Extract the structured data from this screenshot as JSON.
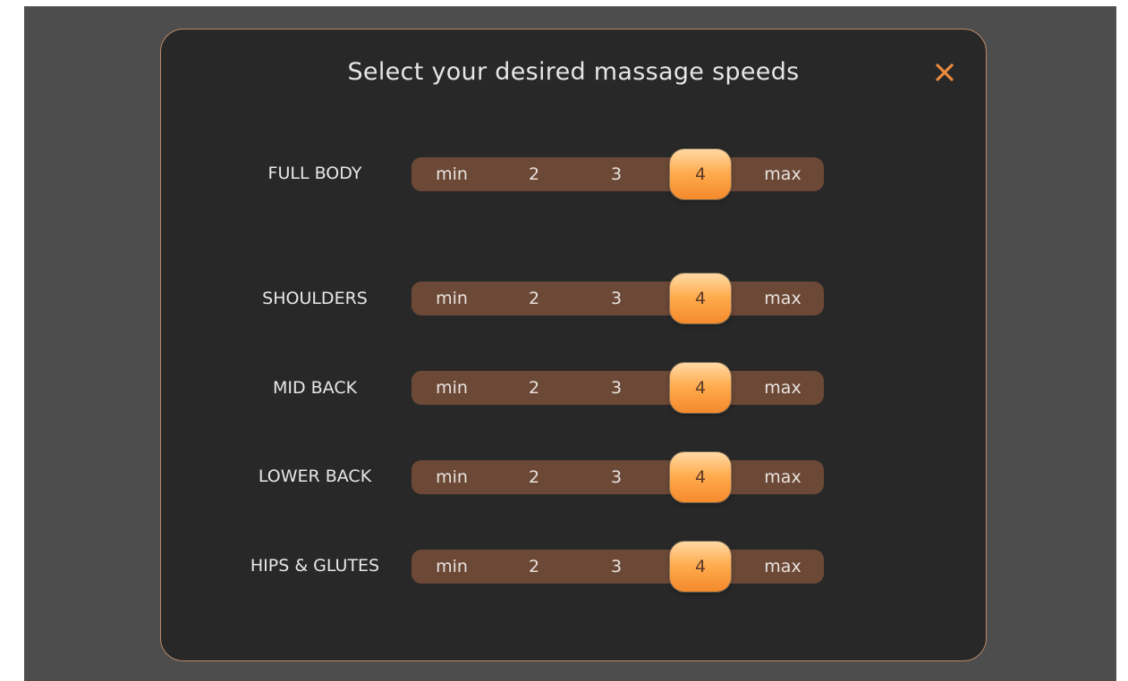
{
  "dialog": {
    "title": "Select your desired massage speeds",
    "close_icon": "close-icon",
    "accent_color": "#e98a3c"
  },
  "speed_options": [
    "min",
    "2",
    "3",
    "4",
    "max"
  ],
  "rows": [
    {
      "label": "FULL BODY",
      "selected": "4"
    },
    {
      "label": "SHOULDERS",
      "selected": "4"
    },
    {
      "label": "MID BACK",
      "selected": "4"
    },
    {
      "label": "LOWER BACK",
      "selected": "4"
    },
    {
      "label": "HIPS & GLUTES",
      "selected": "4"
    }
  ]
}
